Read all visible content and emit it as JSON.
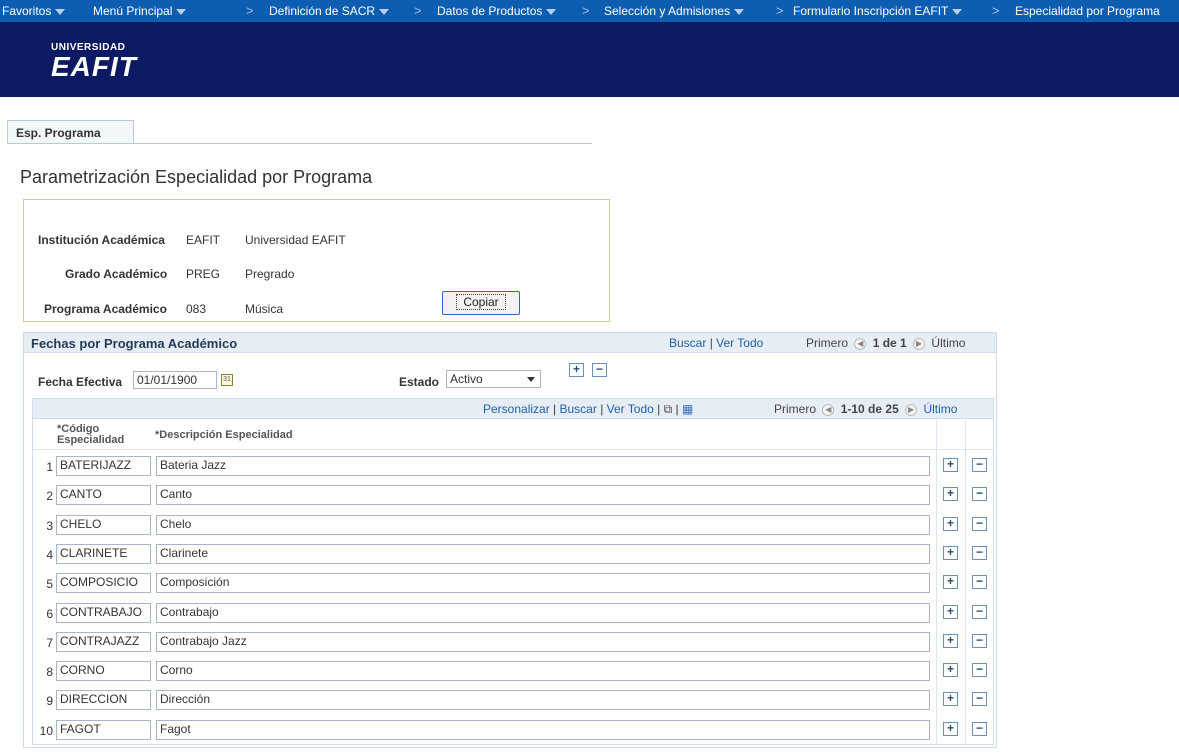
{
  "nav": {
    "items": [
      {
        "label": "Favoritos",
        "caret": true
      },
      {
        "label": "Menú Principal",
        "caret": true
      },
      {
        "label": "Definición de SACR",
        "caret": true
      },
      {
        "label": "Datos de Productos",
        "caret": true
      },
      {
        "label": "Selección y Admisiones",
        "caret": true
      },
      {
        "label": "Formulario Inscripción EAFIT",
        "caret": true
      },
      {
        "label": "Especialidad por Programa",
        "caret": false
      }
    ],
    "separator": ">"
  },
  "logo": {
    "line1": "UNIVERSIDAD",
    "line2": "EAFIT"
  },
  "tab": {
    "label": "Esp. Programa"
  },
  "page_title": "Parametrización Especialidad por Programa",
  "info": {
    "institucion_label": "Institución Académica",
    "institucion_code": "EAFIT",
    "institucion_desc": "Universidad EAFIT",
    "grado_label": "Grado Académico",
    "grado_code": "PREG",
    "grado_desc": "Pregrado",
    "programa_label": "Programa Académico",
    "programa_code": "083",
    "programa_desc": "Música",
    "copy_button": "Copiar"
  },
  "fechas": {
    "title": "Fechas por Programa Académico",
    "buscar": "Buscar",
    "ver_todo": "Ver Todo",
    "primero": "Primero",
    "range": "1 de 1",
    "ultimo": "Último",
    "fecha_label": "Fecha Efectiva",
    "fecha_value": "01/01/1900",
    "estado_label": "Estado",
    "estado_value": "Activo"
  },
  "grid": {
    "personalizar": "Personalizar",
    "buscar": "Buscar",
    "ver_todo": "Ver Todo",
    "primero": "Primero",
    "range": "1-10 de 25",
    "ultimo": "Último",
    "col_codigo_1": "*Código",
    "col_codigo_2": "Especialidad",
    "col_desc": "*Descripción Especialidad",
    "rows": [
      {
        "num": "1",
        "code": "BATERIJAZZ",
        "desc": "Bateria Jazz"
      },
      {
        "num": "2",
        "code": "CANTO",
        "desc": "Canto"
      },
      {
        "num": "3",
        "code": "CHELO",
        "desc": "Chelo"
      },
      {
        "num": "4",
        "code": "CLARINETE",
        "desc": "Clarinete"
      },
      {
        "num": "5",
        "code": "COMPOSICIO",
        "desc": "Composición"
      },
      {
        "num": "6",
        "code": "CONTRABAJO",
        "desc": "Contrabajo"
      },
      {
        "num": "7",
        "code": "CONTRAJAZZ",
        "desc": "Contrabajo Jazz"
      },
      {
        "num": "8",
        "code": "CORNO",
        "desc": "Corno"
      },
      {
        "num": "9",
        "code": "DIRECCION",
        "desc": "Dirección"
      },
      {
        "num": "10",
        "code": "FAGOT",
        "desc": "Fagot"
      }
    ]
  },
  "colors": {
    "nav": "#0d5eb0",
    "header": "#0c1a63",
    "link": "#1f5fa8",
    "grid_header": "#e7edf4"
  }
}
